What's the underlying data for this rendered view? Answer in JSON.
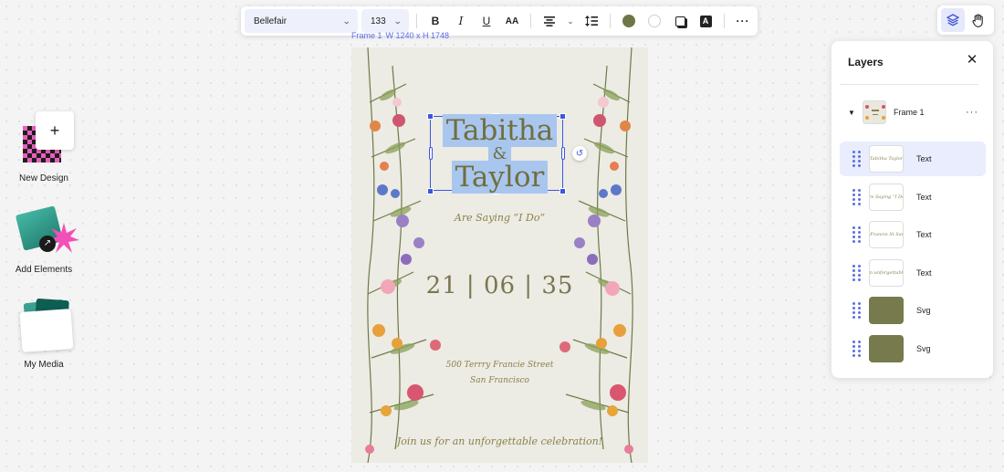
{
  "left_rail": {
    "new_design": {
      "label": "New Design",
      "icon": "plus-icon"
    },
    "add_elements": {
      "label": "Add Elements",
      "icon": "arrow-up-right-icon"
    },
    "my_media": {
      "label": "My Media"
    }
  },
  "toolbar": {
    "font_family": "Bellefair",
    "font_size": "133",
    "bold_icon": "B",
    "italic_icon": "I",
    "underline_icon": "U",
    "case_icon": "AA",
    "text_color": "#707548",
    "highlight_color": "none",
    "text_style_icon": "A",
    "more_icon": "···"
  },
  "mode_toggle": {
    "layers_icon": "layers-icon",
    "hand_icon": "hand-icon"
  },
  "canvas": {
    "frame_label": "Frame 1",
    "frame_dims": "W 1240 x H 1748",
    "names_line1": "Tabitha",
    "names_amp": "&",
    "names_line2": "Taylor",
    "tagline": "Are Saying “I Do”",
    "date": "21 | 06 | 35",
    "address_line1": "500 Terrry Francie Street",
    "address_line2": "San Francisco",
    "invite_text": "Join us for an unforgettable celebration!",
    "colors": {
      "paper": "#ecebe4",
      "text_olive": "#6f6f3e",
      "selection": "#3c56e0",
      "highlight": "#a9c6ef"
    }
  },
  "layers_panel": {
    "title": "Layers",
    "frame": {
      "name": "Frame 1",
      "more": "···"
    },
    "items": [
      {
        "name": "Text",
        "thumb": "Tabitha Taylor",
        "kind": "text",
        "active": true
      },
      {
        "name": "Text",
        "thumb": "Are Saying “I Do”",
        "kind": "text",
        "active": false
      },
      {
        "name": "Text",
        "thumb": "500 Terrry Francie St San Francisco",
        "kind": "text",
        "active": false
      },
      {
        "name": "Text",
        "thumb": "an unforgettable",
        "kind": "text",
        "active": false
      },
      {
        "name": "Svg",
        "thumb": "",
        "kind": "svg",
        "active": false,
        "color": "#767a4d"
      },
      {
        "name": "Svg",
        "thumb": "",
        "kind": "svg",
        "active": false,
        "color": "#767a4d"
      }
    ]
  }
}
